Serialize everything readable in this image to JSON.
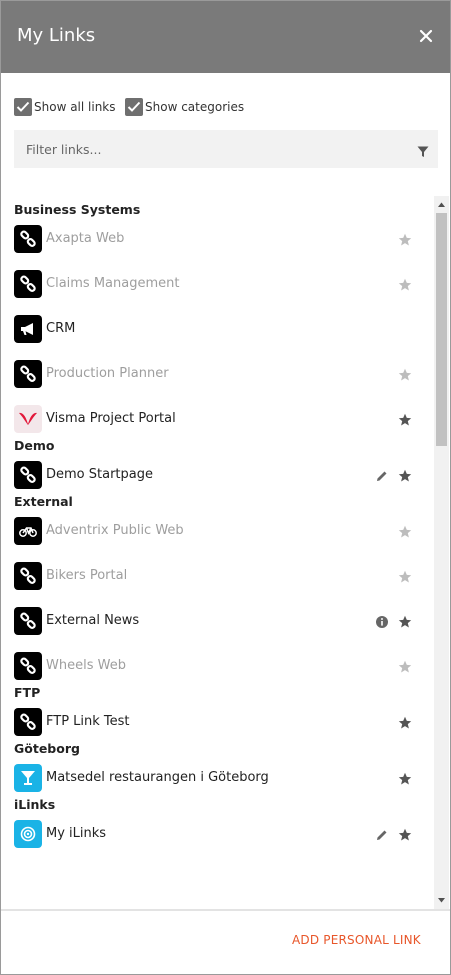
{
  "header": {
    "title": "My Links",
    "close_icon": "close-icon"
  },
  "options": {
    "show_all_links": "Show all links",
    "show_categories": "Show categories"
  },
  "filter": {
    "placeholder": "Filter links..."
  },
  "categories": [
    {
      "label": "Business Systems",
      "links": [
        {
          "label": "Axapta Web",
          "icon": "link-icon",
          "dim": true,
          "star": "gray"
        },
        {
          "label": "Claims Management",
          "icon": "link-icon",
          "dim": true,
          "star": "gray"
        },
        {
          "label": "CRM",
          "icon": "megaphone-icon",
          "dim": false,
          "star": "none"
        },
        {
          "label": "Production Planner",
          "icon": "link-icon",
          "dim": true,
          "star": "gray"
        },
        {
          "label": "Visma Project Portal",
          "icon": "visma-logo-icon",
          "dim": false,
          "star": "dark"
        }
      ]
    },
    {
      "label": "Demo",
      "links": [
        {
          "label": "Demo Startpage",
          "icon": "link-icon",
          "dim": false,
          "star": "dark",
          "extra": "pencil-icon"
        }
      ]
    },
    {
      "label": "External",
      "links": [
        {
          "label": "Adventrix Public Web",
          "icon": "bicycle-icon",
          "dim": true,
          "star": "gray"
        },
        {
          "label": "Bikers Portal",
          "icon": "link-icon",
          "dim": true,
          "star": "gray"
        },
        {
          "label": "External News",
          "icon": "link-icon",
          "dim": false,
          "star": "dark",
          "extra": "info-icon"
        },
        {
          "label": "Wheels Web",
          "icon": "link-icon",
          "dim": true,
          "star": "gray"
        }
      ]
    },
    {
      "label": "FTP",
      "links": [
        {
          "label": "FTP Link Test",
          "icon": "link-icon",
          "dim": false,
          "star": "dark"
        }
      ]
    },
    {
      "label": "Göteborg",
      "links": [
        {
          "label": "Matsedel restaurangen i Göteborg",
          "icon": "cocktail-icon",
          "dim": false,
          "star": "dark"
        }
      ]
    },
    {
      "label": "iLinks",
      "links": [
        {
          "label": "My iLinks",
          "icon": "target-icon",
          "dim": false,
          "star": "dark",
          "extra": "pencil-icon"
        }
      ]
    }
  ],
  "footer": {
    "add_personal_link": "ADD PERSONAL LINK"
  },
  "colors": {
    "header_bg": "#7a7a7a",
    "accent": "#e8562a",
    "icon_bg": "#000000",
    "teal": "#1ab3e6"
  }
}
